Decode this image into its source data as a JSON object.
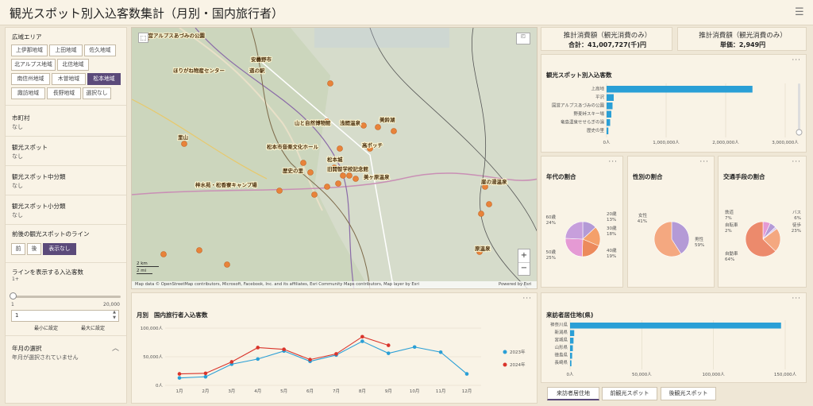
{
  "title": "観光スポット別入込客数集計（月別・国内旅行者）",
  "sidebar": {
    "area_label": "広域エリア",
    "areas": [
      "上伊那地域",
      "上田地域",
      "佐久地域",
      "北アルプス地域",
      "北信地域",
      "南信州地域",
      "木曽地域",
      "松本地域",
      "諏訪地域",
      "長野地域",
      "選択なし"
    ],
    "area_selected": "松本地域",
    "city_label": "市町村",
    "city_value": "なし",
    "spot_label": "観光スポット",
    "spot_value": "なし",
    "mid_label": "観光スポット中分類",
    "mid_value": "なし",
    "small_label": "観光スポット小分類",
    "small_value": "なし",
    "line_label": "前後の観光スポットのライン",
    "line_options": [
      "前",
      "後",
      "表示なし"
    ],
    "line_selected": "表示なし",
    "min_label": "ラインを表示する入込客数",
    "min_hint": "1+",
    "slider_min": "1",
    "slider_max": "20,000",
    "slider_level": 0.0,
    "input_value": "1",
    "min_set": "最小に設定",
    "max_set": "最大に設定",
    "ym_label": "年月の選択",
    "ym_value": "年月が選択されていません"
  },
  "map": {
    "labels": [
      "国営アルプスあづみの公園",
      "ほりがね物産センター",
      "道の駅",
      "安曇野市",
      "山と自然博物館",
      "浅間温泉",
      "美鈴湖",
      "松本市音楽文化ホール",
      "里山",
      "松本城",
      "高ボッチ",
      "歴史の里",
      "旧開智学校記念館",
      "梓水苑・松香寮キャンプ場",
      "美ヶ原温泉",
      "崖の湯温泉",
      "原温泉"
    ],
    "scale": [
      "2 km",
      "2 mi"
    ],
    "attribution": "Map data © OpenStreetMap contributors, Microsoft, Facebook, Inc. and its affiliates, Esri Community Maps contributors, Map layer by Esri",
    "powered": "Powered by Esri",
    "zoom_in": "+",
    "zoom_out": "−"
  },
  "kpi": [
    {
      "title": "推計消費額（観光消費のみ）",
      "value": "合計：41,007,727(千)円"
    },
    {
      "title": "推計消費額（観光消費のみ）",
      "value": "単価：2,949円"
    }
  ],
  "spot_chart": {
    "title": "観光スポット別入込客数",
    "categories": [
      "上高地",
      "平沢",
      "国営アルプスあづみの公園",
      "野麦峠スキー場",
      "竜島温泉せせらぎの湯",
      "歴史の里"
    ],
    "values": [
      2450000,
      120000,
      100000,
      80000,
      60000,
      30000
    ],
    "ticks": [
      "0人",
      "1,000,000人",
      "2,000,000人",
      "3,000,000人"
    ],
    "xmax": 3000000
  },
  "age_chart": {
    "title": "年代の割合",
    "labels": [
      "20歳",
      "30歳",
      "40歳",
      "50歳",
      "60歳"
    ],
    "values": [
      13,
      18,
      19,
      25,
      24
    ],
    "pcts": [
      "13%",
      "18%",
      "19%",
      "25%",
      "24%"
    ],
    "colors": [
      "#b49ad6",
      "#f4a06a",
      "#ec8a5c",
      "#e59ad4",
      "#c79fdc"
    ]
  },
  "gender_chart": {
    "title": "性別の割合",
    "labels": [
      "女性",
      "男性"
    ],
    "values": [
      41,
      59
    ],
    "pcts": [
      "41%",
      "59%"
    ],
    "colors": [
      "#b49ad6",
      "#f4a880"
    ]
  },
  "transport_chart": {
    "title": "交通手段の割合",
    "labels": [
      "鉄道",
      "バス",
      "自転車",
      "徒歩",
      "自動車"
    ],
    "values": [
      7,
      6,
      2,
      23,
      64
    ],
    "pcts": [
      "7%",
      "6%",
      "2%",
      "23%",
      "64%"
    ],
    "colors": [
      "#e59ad4",
      "#b49ad6",
      "#d8c8e8",
      "#f4a880",
      "#ec8a6c"
    ]
  },
  "monthly_chart": {
    "header": "月別",
    "title": "国内旅行者入込客数",
    "categories": [
      "1月",
      "2月",
      "3月",
      "4月",
      "5月",
      "6月",
      "7月",
      "8月",
      "9月",
      "10月",
      "11月",
      "12月"
    ],
    "series": [
      {
        "name": "2023年",
        "color": "#2a9fd6",
        "values": [
          13000,
          15000,
          37000,
          46000,
          60000,
          42000,
          53000,
          77000,
          56000,
          67000,
          58000,
          20000
        ]
      },
      {
        "name": "2024年",
        "color": "#d9342b",
        "values": [
          20000,
          21000,
          41000,
          66000,
          63000,
          45000,
          55000,
          85000,
          70000,
          null,
          null,
          null
        ]
      }
    ],
    "yticks": [
      "0人",
      "50,000人",
      "100,000人"
    ],
    "ymax": 100000
  },
  "residence_chart": {
    "title": "来訪者居住地(県)",
    "categories": [
      "神奈川県",
      "新潟県",
      "宮城県",
      "山形県",
      "徳島県",
      "長崎県"
    ],
    "values": [
      152000,
      3000,
      2500,
      2000,
      1500,
      1000
    ],
    "ticks": [
      "0人",
      "50,000人",
      "100,000人",
      "150,000人"
    ],
    "xmax": 155000
  },
  "bottom_tabs": [
    "来訪者居住地",
    "前観光スポット",
    "後観光スポット"
  ],
  "menu_icon": "menu-icon",
  "more_icon": "···"
}
